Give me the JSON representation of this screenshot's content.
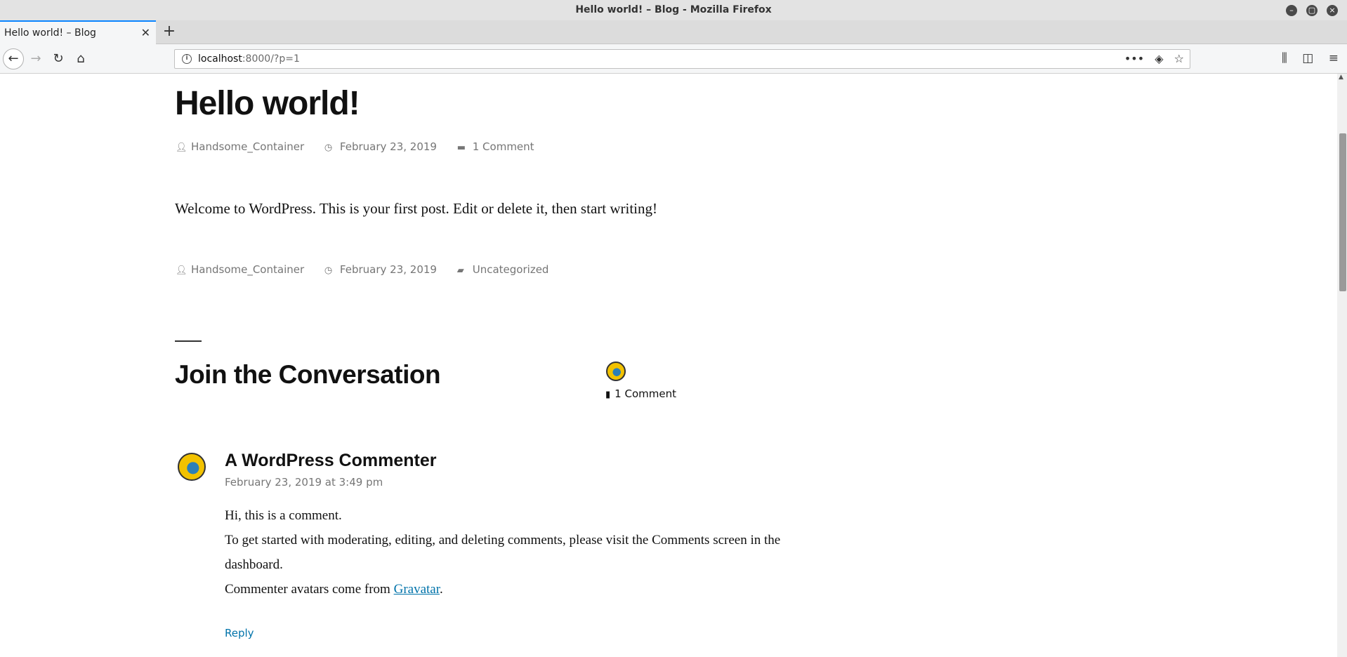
{
  "window": {
    "title": "Hello world! – Blog - Mozilla Firefox",
    "controls": [
      "minimize-icon",
      "maximize-icon",
      "close-icon"
    ]
  },
  "tabs": [
    {
      "label": "Hello world! – Blog",
      "active": true
    }
  ],
  "navbar": {
    "url_host": "localhost",
    "url_rest": ":8000/?p=1",
    "icons": [
      "back-icon",
      "forward-icon",
      "reload-icon",
      "home-icon",
      "page-actions-icon",
      "pocket-icon",
      "bookmark-star-icon",
      "library-icon",
      "sidebar-icon",
      "menu-icon"
    ]
  },
  "post": {
    "title": "Hello world!",
    "author": "Handsome_Container",
    "date": "February 23, 2019",
    "comments_link": "1 Comment",
    "body": "Welcome to WordPress. This is your first post. Edit or delete it, then start writing!",
    "footer_author": "Handsome_Container",
    "footer_date": "February 23, 2019",
    "category": "Uncategorized"
  },
  "conversation": {
    "title": "Join the Conversation",
    "count_label": "1 Comment"
  },
  "comment": {
    "author": "A WordPress Commenter",
    "date": "February 23, 2019 at 3:49 pm",
    "line1": "Hi, this is a comment.",
    "line2": "To get started with moderating, editing, and deleting comments, please visit the Comments screen in the dashboard.",
    "line3_prefix": "Commenter avatars come from ",
    "line3_link": "Gravatar",
    "line3_suffix": ".",
    "reply_label": "Reply"
  },
  "colors": {
    "accent": "#0073aa",
    "meta_gray": "#767676",
    "tab_highlight": "#0a84ff"
  }
}
